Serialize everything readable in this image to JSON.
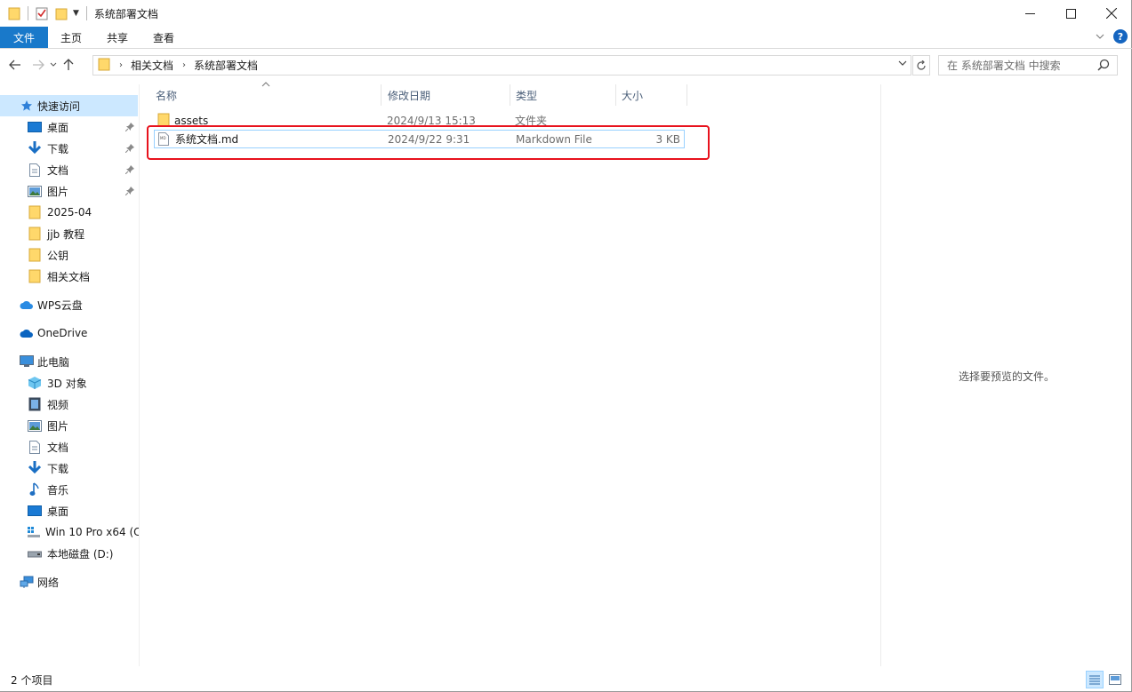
{
  "window": {
    "title": "系统部署文档"
  },
  "ribbon": {
    "tabs": [
      {
        "label": "文件"
      },
      {
        "label": "主页"
      },
      {
        "label": "共享"
      },
      {
        "label": "查看"
      }
    ],
    "help_label": "?"
  },
  "address_bar": {
    "breadcrumbs": [
      {
        "label": "相关文档"
      },
      {
        "label": "系统部署文档"
      }
    ]
  },
  "search": {
    "placeholder": "在 系统部署文档 中搜索"
  },
  "sidebar": {
    "quick_access": {
      "label": "快速访问",
      "items": [
        {
          "label": "桌面",
          "icon": "desktop-icon",
          "pinned": true
        },
        {
          "label": "下载",
          "icon": "download-icon",
          "pinned": true
        },
        {
          "label": "文档",
          "icon": "document-icon",
          "pinned": true
        },
        {
          "label": "图片",
          "icon": "picture-icon",
          "pinned": true
        },
        {
          "label": "2025-04",
          "icon": "folder-icon",
          "pinned": false
        },
        {
          "label": "jjb 教程",
          "icon": "folder-icon",
          "pinned": false
        },
        {
          "label": "公钥",
          "icon": "folder-icon",
          "pinned": false
        },
        {
          "label": "相关文档",
          "icon": "folder-icon",
          "pinned": false
        }
      ]
    },
    "wps_cloud": {
      "label": "WPS云盘"
    },
    "onedrive": {
      "label": "OneDrive"
    },
    "this_pc": {
      "label": "此电脑",
      "items": [
        {
          "label": "3D 对象",
          "icon": "3d-objects-icon"
        },
        {
          "label": "视频",
          "icon": "video-icon"
        },
        {
          "label": "图片",
          "icon": "picture-icon"
        },
        {
          "label": "文档",
          "icon": "document-icon"
        },
        {
          "label": "下载",
          "icon": "download-icon"
        },
        {
          "label": "音乐",
          "icon": "music-icon"
        },
        {
          "label": "桌面",
          "icon": "desktop-icon"
        },
        {
          "label": "Win 10 Pro x64 (C",
          "icon": "windows-drive-icon"
        },
        {
          "label": "本地磁盘 (D:)",
          "icon": "drive-icon"
        }
      ]
    },
    "network": {
      "label": "网络"
    }
  },
  "file_list": {
    "columns": [
      {
        "label": "名称"
      },
      {
        "label": "修改日期"
      },
      {
        "label": "类型"
      },
      {
        "label": "大小"
      }
    ],
    "rows": [
      {
        "name": "assets",
        "date": "2024/9/13 15:13",
        "type": "文件夹",
        "size": "",
        "icon": "folder-icon"
      },
      {
        "name": "系统文档.md",
        "date": "2024/9/22 9:31",
        "type": "Markdown File",
        "size": "3 KB",
        "icon": "markdown-file-icon"
      }
    ]
  },
  "preview": {
    "message": "选择要预览的文件。"
  },
  "status_bar": {
    "item_count": "2 个项目"
  },
  "colors": {
    "accent": "#1979ca",
    "selection": "#cce8ff",
    "highlight_box": "#e8121d"
  }
}
